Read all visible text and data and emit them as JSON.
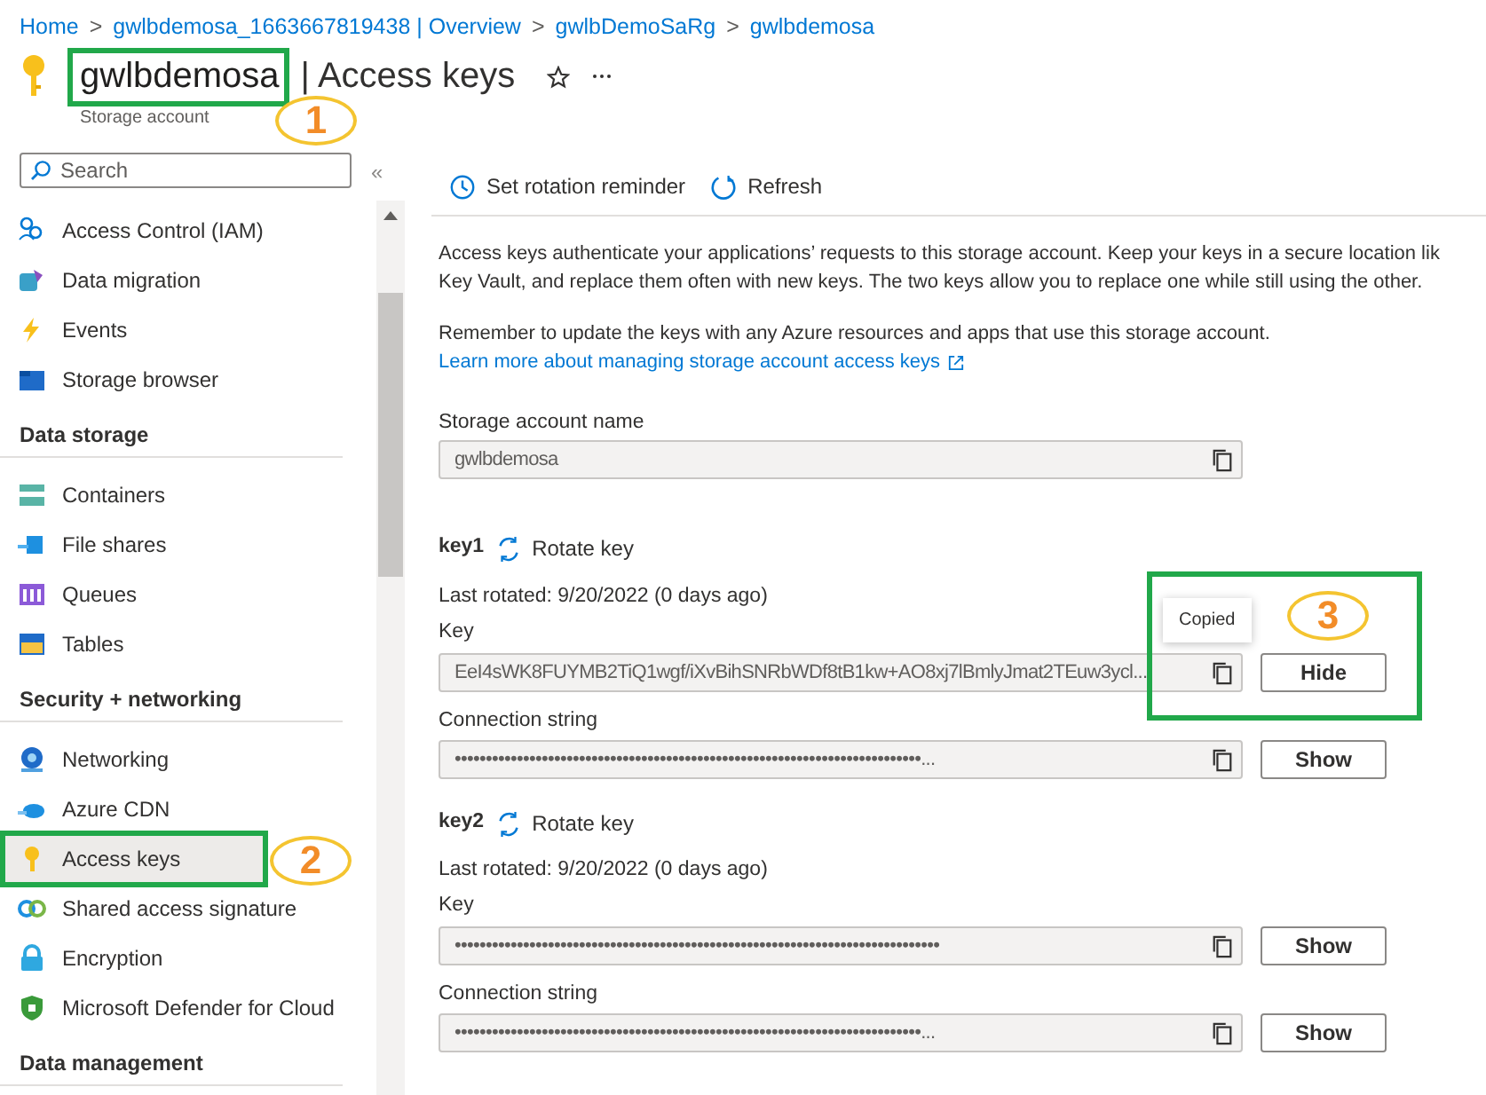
{
  "breadcrumb": [
    "Home",
    "gwlbdemosa_1663667819438 | Overview",
    "gwlbDemoSaRg",
    "gwlbdemosa"
  ],
  "breadcrumb_separator": ">",
  "title": {
    "name": "gwlbdemosa",
    "page": "| Access keys",
    "subtitle": "Storage account"
  },
  "search": {
    "placeholder": "Search"
  },
  "collapse": "«",
  "sidebar": [
    {
      "kind": "item",
      "label": "Access Control (IAM)",
      "selected": false
    },
    {
      "kind": "item",
      "label": "Data migration",
      "selected": false
    },
    {
      "kind": "item",
      "label": "Events",
      "selected": false
    },
    {
      "kind": "item",
      "label": "Storage browser",
      "selected": false
    },
    {
      "kind": "heading",
      "label": "Data storage"
    },
    {
      "kind": "item",
      "label": "Containers",
      "selected": false
    },
    {
      "kind": "item",
      "label": "File shares",
      "selected": false
    },
    {
      "kind": "item",
      "label": "Queues",
      "selected": false
    },
    {
      "kind": "item",
      "label": "Tables",
      "selected": false
    },
    {
      "kind": "heading",
      "label": "Security + networking"
    },
    {
      "kind": "item",
      "label": "Networking",
      "selected": false
    },
    {
      "kind": "item",
      "label": "Azure CDN",
      "selected": false
    },
    {
      "kind": "item",
      "label": "Access keys",
      "selected": true
    },
    {
      "kind": "item",
      "label": "Shared access signature",
      "selected": false
    },
    {
      "kind": "item",
      "label": "Encryption",
      "selected": false
    },
    {
      "kind": "item",
      "label": "Microsoft Defender for Cloud",
      "selected": false
    },
    {
      "kind": "heading",
      "label": "Data management"
    }
  ],
  "toolbar": [
    "Set rotation reminder",
    "Refresh"
  ],
  "intro": [
    "Access keys authenticate your applications’ requests to this storage account. Keep your keys in a secure location lik",
    "Key Vault, and replace them often with new keys. The two keys allow you to replace one while still using the other.",
    "Remember to update the keys with any Azure resources and apps that use this storage account."
  ],
  "learn_link": "Learn more about managing storage account access keys",
  "account": {
    "label": "Storage account name",
    "value": "gwlbdemosa"
  },
  "keys": [
    {
      "name": "key1",
      "rotate": "Rotate key",
      "last_rotated": "Last rotated: 9/20/2022 (0 days ago)",
      "fields": [
        {
          "label": "Key",
          "value": "EeI4sWK8FUYMB2TiQ1wgf/iXvBihSNRbWDf8tB1kw+AO8xj7lBmlyJmat2TEuw3ycl...",
          "button": "Hide",
          "tooltip": "Copied"
        },
        {
          "label": "Connection string",
          "value": "•••••••••••••••••••••••••••••••••••••••••••••••••••••••••••••••••••••••••••...",
          "button": "Show"
        }
      ]
    },
    {
      "name": "key2",
      "rotate": "Rotate key",
      "last_rotated": "Last rotated: 9/20/2022 (0 days ago)",
      "fields": [
        {
          "label": "Key",
          "value": "••••••••••••••••••••••••••••••••••••••••••••••••••••••••••••••••••••••••••••••",
          "button": "Show"
        },
        {
          "label": "Connection string",
          "value": "•••••••••••••••••••••••••••••••••••••••••••••••••••••••••••••••••••••••••••...",
          "button": "Show"
        }
      ]
    }
  ],
  "callouts": [
    {
      "number": "1"
    },
    {
      "number": "2"
    },
    {
      "number": "3"
    }
  ]
}
